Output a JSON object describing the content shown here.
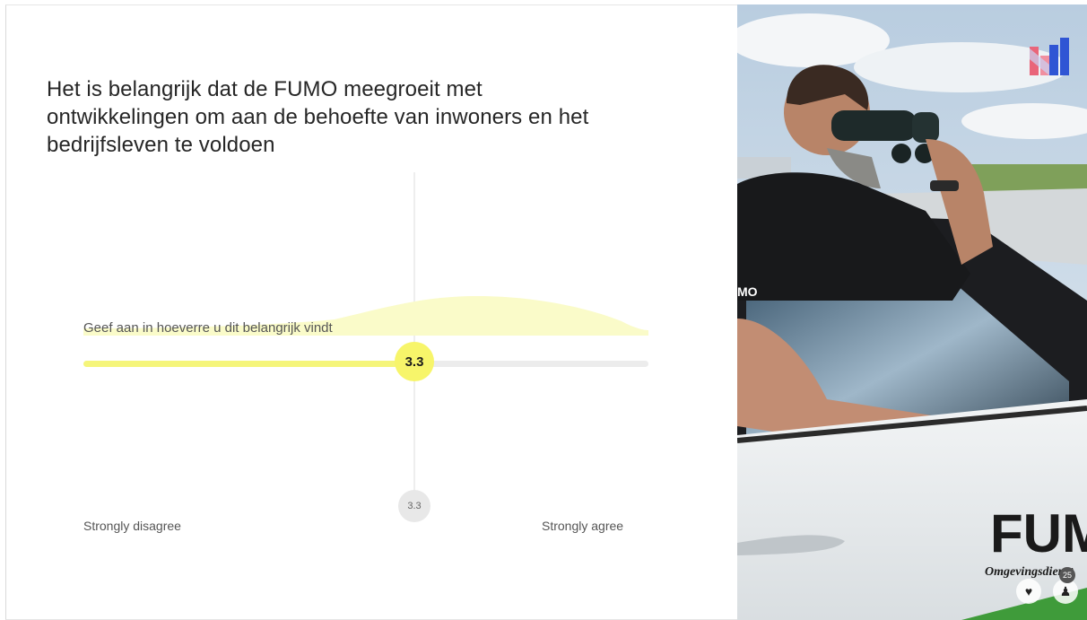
{
  "slide": {
    "title": "Het is belangrijk dat de FUMO meegroeit met ontwikkelingen om aan de behoefte van inwoners en het bedrijfsleven te voldoen",
    "scale_label": "Geef aan in hoeverre u dit belangrijk vindt",
    "current_value": "3.3",
    "average_value": "3.3",
    "min_label": "Strongly disagree",
    "max_label": "Strongly agree",
    "colors": {
      "accent": "#f7f56a",
      "track": "#ececec",
      "text": "#262626"
    }
  },
  "photo": {
    "door_text": "FUM",
    "door_subtext": "Omgevingsdienst",
    "shirt_text": "MO"
  },
  "hud": {
    "like_icon": "heart-icon",
    "participants_icon": "person-icon",
    "participants_count": "25"
  }
}
